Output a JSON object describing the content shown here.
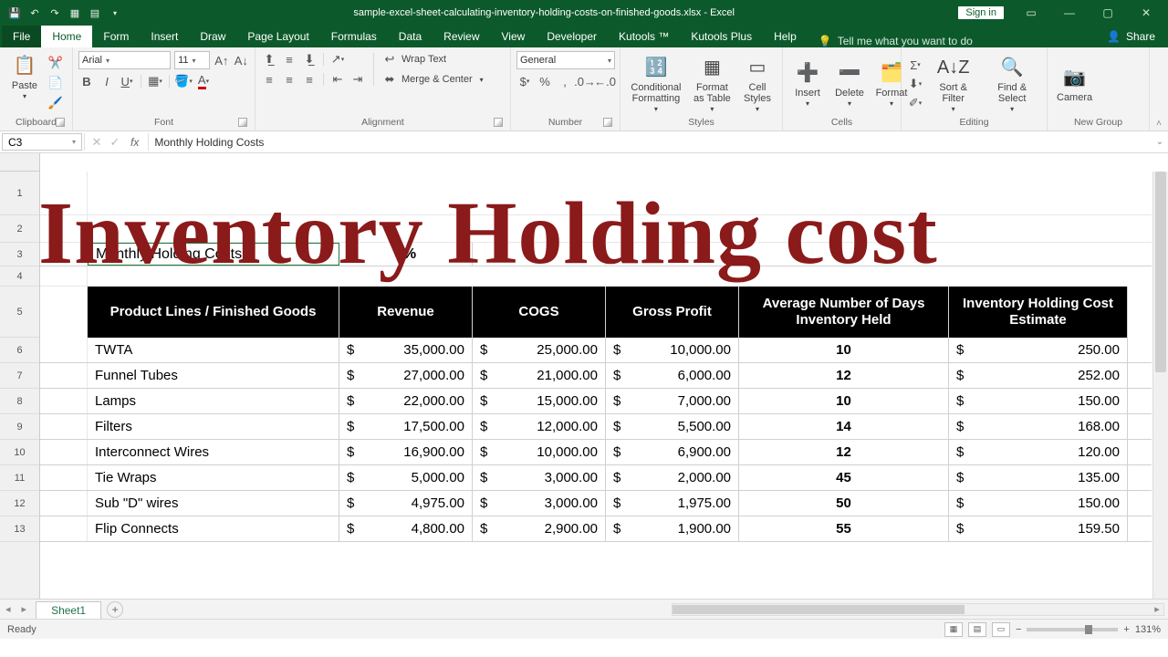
{
  "app": {
    "title_doc": "sample-excel-sheet-calculating-inventory-holding-costs-on-finished-goods.xlsx",
    "title_app": "Excel",
    "signin": "Sign in"
  },
  "menutabs": [
    "File",
    "Home",
    "Form",
    "Insert",
    "Draw",
    "Page Layout",
    "Formulas",
    "Data",
    "Review",
    "View",
    "Developer",
    "Kutools ™",
    "Kutools Plus",
    "Help"
  ],
  "tellme": "Tell me what you want to do",
  "share": "Share",
  "ribbon": {
    "clipboard": {
      "paste": "Paste",
      "label": "Clipboard"
    },
    "font": {
      "name": "Arial",
      "size": "11",
      "label": "Font"
    },
    "alignment": {
      "wrap": "Wrap Text",
      "merge": "Merge & Center",
      "label": "Alignment"
    },
    "number": {
      "format": "General",
      "label": "Number"
    },
    "styles": {
      "cond": "Conditional Formatting",
      "table": "Format as Table",
      "cell": "Cell Styles",
      "label": "Styles"
    },
    "cells": {
      "insert": "Insert",
      "delete": "Delete",
      "format": "Format",
      "label": "Cells"
    },
    "editing": {
      "sort": "Sort & Filter",
      "find": "Find & Select",
      "label": "Editing"
    },
    "newgroup": {
      "camera": "Camera",
      "label": "New Group"
    }
  },
  "fbar": {
    "cell": "C3",
    "content": "Monthly Holding Costs"
  },
  "overlay": "Inventory Holding cost",
  "sheet": {
    "monthly_label": "Monthly Holding Costs",
    "monthly_value": "3%",
    "headers": [
      "Product Lines / Finished Goods",
      "Revenue",
      "COGS",
      "Gross Profit",
      "Average Number of Days Inventory Held",
      "Inventory Holding Cost Estimate"
    ],
    "rows": [
      {
        "n": "6",
        "prod": "TWTA",
        "rev": "35,000.00",
        "cogs": "25,000.00",
        "gp": "10,000.00",
        "days": "10",
        "est": "250.00"
      },
      {
        "n": "7",
        "prod": "Funnel Tubes",
        "rev": "27,000.00",
        "cogs": "21,000.00",
        "gp": "6,000.00",
        "days": "12",
        "est": "252.00"
      },
      {
        "n": "8",
        "prod": "Lamps",
        "rev": "22,000.00",
        "cogs": "15,000.00",
        "gp": "7,000.00",
        "days": "10",
        "est": "150.00"
      },
      {
        "n": "9",
        "prod": "Filters",
        "rev": "17,500.00",
        "cogs": "12,000.00",
        "gp": "5,500.00",
        "days": "14",
        "est": "168.00"
      },
      {
        "n": "10",
        "prod": "Interconnect Wires",
        "rev": "16,900.00",
        "cogs": "10,000.00",
        "gp": "6,900.00",
        "days": "12",
        "est": "120.00"
      },
      {
        "n": "11",
        "prod": "Tie Wraps",
        "rev": "5,000.00",
        "cogs": "3,000.00",
        "gp": "2,000.00",
        "days": "45",
        "est": "135.00"
      },
      {
        "n": "12",
        "prod": "Sub \"D\" wires",
        "rev": "4,975.00",
        "cogs": "3,000.00",
        "gp": "1,975.00",
        "days": "50",
        "est": "150.00"
      },
      {
        "n": "13",
        "prod": "Flip Connects",
        "rev": "4,800.00",
        "cogs": "2,900.00",
        "gp": "1,900.00",
        "days": "55",
        "est": "159.50"
      }
    ]
  },
  "tabs": {
    "sheet1": "Sheet1"
  },
  "status": {
    "ready": "Ready",
    "zoom": "131%"
  },
  "chart_data": {
    "type": "table",
    "title": "Inventory Holding Cost",
    "monthly_holding_cost_pct": 3,
    "columns": [
      "Product Lines / Finished Goods",
      "Revenue",
      "COGS",
      "Gross Profit",
      "Average Number of Days Inventory Held",
      "Inventory Holding Cost Estimate"
    ],
    "rows": [
      [
        "TWTA",
        35000.0,
        25000.0,
        10000.0,
        10,
        250.0
      ],
      [
        "Funnel Tubes",
        27000.0,
        21000.0,
        6000.0,
        12,
        252.0
      ],
      [
        "Lamps",
        22000.0,
        15000.0,
        7000.0,
        10,
        150.0
      ],
      [
        "Filters",
        17500.0,
        12000.0,
        5500.0,
        14,
        168.0
      ],
      [
        "Interconnect Wires",
        16900.0,
        10000.0,
        6900.0,
        12,
        120.0
      ],
      [
        "Tie Wraps",
        5000.0,
        3000.0,
        2000.0,
        45,
        135.0
      ],
      [
        "Sub \"D\" wires",
        4975.0,
        3000.0,
        1975.0,
        50,
        150.0
      ],
      [
        "Flip Connects",
        4800.0,
        2900.0,
        1900.0,
        55,
        159.5
      ]
    ]
  }
}
